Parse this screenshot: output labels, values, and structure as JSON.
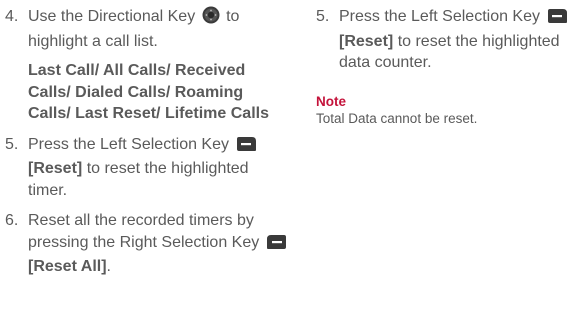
{
  "left": {
    "step4": {
      "num": "4.",
      "text_before_icon": "Use the Directional Key",
      "icon": "directional-key-icon",
      "text_after_icon": "to highlight a call list."
    },
    "call_lists": "Last Call/ All Calls/ Received Calls/ Dialed Calls/ Roaming Calls/ Last Reset/ Lifetime Calls",
    "step5": {
      "num": "5.",
      "text_before_icon": "Press the Left Selection Key",
      "icon": "left-selection-key-icon",
      "bold_label": "[Reset]",
      "text_after": "to reset the highlighted timer."
    },
    "step6": {
      "num": "6.",
      "text_before_icon": "Reset all the recorded timers by pressing the Right Selection Key",
      "icon": "right-selection-key-icon",
      "bold_label": "[Reset All]",
      "text_after": "."
    }
  },
  "right": {
    "step5": {
      "num": "5.",
      "text_before_icon": "Press the Left Selection Key",
      "icon": "left-selection-key-icon",
      "bold_label": "[Reset]",
      "text_after": "to reset the highlighted data counter."
    },
    "note": {
      "title": "Note",
      "text": "Total Data cannot be reset."
    }
  },
  "colors": {
    "body_text": "#5a5a5a",
    "note_title": "#c4133b",
    "key_icon": "#3a3a3a"
  }
}
